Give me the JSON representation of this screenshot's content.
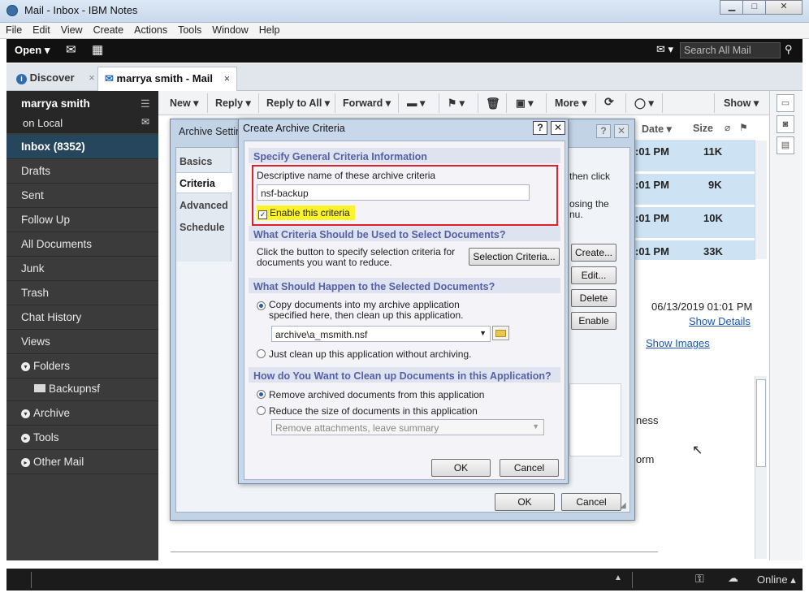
{
  "window": {
    "title": "Mail - Inbox - IBM Notes",
    "min": "▁",
    "max": "□",
    "close": "✕"
  },
  "menu": [
    "File",
    "Edit",
    "View",
    "Create",
    "Actions",
    "Tools",
    "Window",
    "Help"
  ],
  "toolbar": {
    "open_label": "Open",
    "search_placeholder": "Search All Mail"
  },
  "tabs": [
    {
      "label": "Discover",
      "close": "×"
    },
    {
      "label": "marrya smith - Mail",
      "close": "×"
    }
  ],
  "nav": {
    "user": "marrya smith",
    "location": "on Local",
    "items": [
      "Inbox (8352)",
      "Drafts",
      "Sent",
      "Follow Up",
      "All Documents",
      "Junk",
      "Trash",
      "Chat History",
      "Views"
    ],
    "folders": {
      "label": "Folders",
      "children": [
        "Backupnsf"
      ]
    },
    "archive": "Archive",
    "tools": "Tools",
    "other_mail": "Other Mail"
  },
  "actions": {
    "new": "New",
    "reply": "Reply",
    "reply_all": "Reply to All",
    "forward": "Forward",
    "more": "More",
    "show": "Show"
  },
  "list": {
    "header_date": "Date",
    "header_size": "Size",
    "rows": [
      {
        "time": ":01 PM",
        "size": "11K"
      },
      {
        "time": ":01 PM",
        "size": "9K"
      },
      {
        "time": ":01 PM",
        "size": "10K"
      },
      {
        "time": ":01 PM",
        "size": "33K"
      }
    ]
  },
  "preview": {
    "date": "06/13/2019 01:01 PM",
    "show_details": "Show Details",
    "show_images": "Show Images",
    "frag1": "ness",
    "frag2": "orm"
  },
  "archive_settings": {
    "title": "Archive Settin",
    "tabs": [
      "Basics",
      "Criteria",
      "Advanced",
      "Schedule"
    ],
    "frag_then_click": "then click",
    "frag_osing": "osing the",
    "frag_nu": "nu.",
    "buttons": {
      "create": "Create...",
      "edit": "Edit...",
      "delete": "Delete",
      "enable": "Enable"
    },
    "ok": "OK",
    "cancel": "Cancel"
  },
  "criteria": {
    "title": "Create Archive Criteria",
    "sec1": "Specify General Criteria Information",
    "name_label": "Descriptive name of these archive criteria",
    "name_value": "nsf-backup",
    "enable_label": "Enable this criteria",
    "sec2": "What Criteria Should be Used to Select Documents?",
    "sec2_text": "Click the button to specify selection criteria for documents you want to reduce.",
    "selection_btn": "Selection Criteria...",
    "sec3": "What Should Happen to the Selected Documents?",
    "copy_label": "Copy documents into my archive application specified here, then clean up this application.",
    "archive_path": "archive\\a_msmith.nsf",
    "just_clean_label": "Just clean up this application without archiving.",
    "sec4": "How do You Want to Clean up Documents in this Application?",
    "remove_label": "Remove archived documents from this application",
    "reduce_label": "Reduce the size of documents in this application",
    "reduce_option": "Remove attachments, leave summary",
    "ok": "OK",
    "cancel": "Cancel"
  },
  "status": {
    "online": "Online"
  },
  "colors": {
    "highlight_box": "#e0202a",
    "highlight_text_bg": "#fcf32a",
    "inbox_selected": "#26465e"
  }
}
